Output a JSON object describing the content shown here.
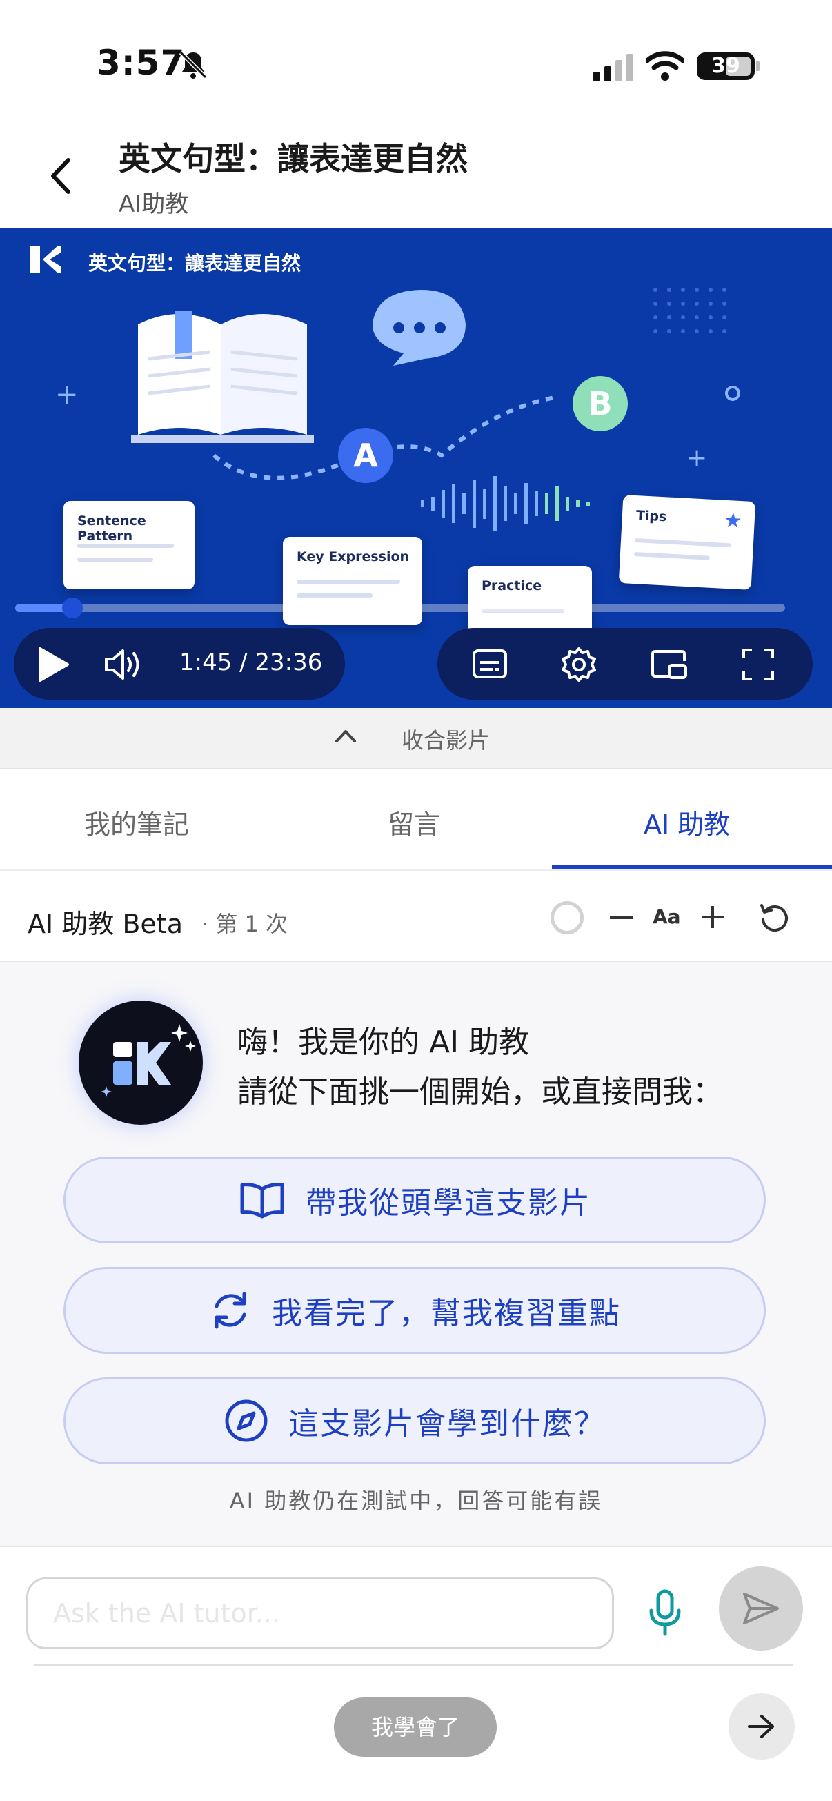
{
  "status_bar": {
    "time": "3:57",
    "battery": "39",
    "icons": [
      "bell-slash-icon",
      "signal-icon",
      "wifi-icon",
      "battery-icon"
    ]
  },
  "header": {
    "title": "英文句型：讓表達更自然",
    "subtitle": "AI助教",
    "back_icon": "chevron-left-icon"
  },
  "video": {
    "caption": "英文句型：讓表達更自然",
    "cards": [
      "Sentence Pattern",
      "Key Expression",
      "Practice",
      "Tips"
    ],
    "bubble_letters": [
      "A",
      "B"
    ],
    "time_display": "1:45 / 23:36",
    "progress": 0.074,
    "accent": "#0a3aa8"
  },
  "collapse": {
    "label": "收合影片"
  },
  "tabs": [
    {
      "label": "我的筆記",
      "active": false
    },
    {
      "label": "留言",
      "active": false
    },
    {
      "label": "AI 助教",
      "active": true
    }
  ],
  "ai_header": {
    "title": "AI 助教 Beta",
    "count": "· 第 1 次",
    "font_label": "Aa"
  },
  "chat": {
    "greeting_line1": "嗨！我是你的 AI 助教",
    "greeting_line2": "請從下面挑一個開始，或直接問我：",
    "options": [
      {
        "label": "帶我從頭學這支影片",
        "icon": "book-icon"
      },
      {
        "label": "我看完了，幫我複習重點",
        "icon": "refresh-icon"
      },
      {
        "label": "這支影片會學到什麼？",
        "icon": "compass-icon"
      }
    ],
    "disclaimer": "AI 助教仍在測試中，回答可能有誤"
  },
  "input": {
    "placeholder": "Ask the AI tutor...",
    "value": ""
  },
  "footer": {
    "learned_label": "我學會了"
  },
  "colors": {
    "brand_blue": "#1d3fc2",
    "mic_teal": "#0f9aa0"
  }
}
